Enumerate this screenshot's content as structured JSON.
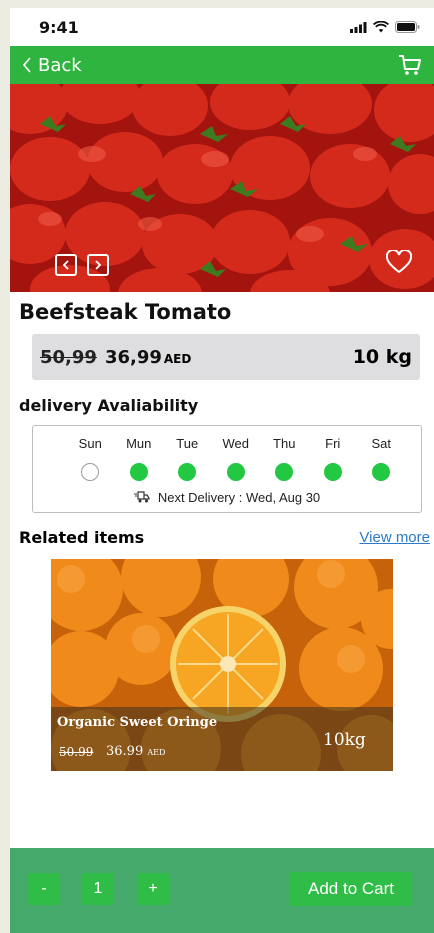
{
  "status": {
    "time": "9:41"
  },
  "nav": {
    "back_label": "Back"
  },
  "product": {
    "name": "Beefsteak Tomato",
    "old_price": "50,99",
    "new_price": "36,99",
    "currency": "AED",
    "weight": "10 kg"
  },
  "delivery": {
    "heading": "delivery Avaliability",
    "days": [
      {
        "label": "Sun",
        "available": false
      },
      {
        "label": "Mun",
        "available": true
      },
      {
        "label": "Tue",
        "available": true
      },
      {
        "label": "Wed",
        "available": true
      },
      {
        "label": "Thu",
        "available": true
      },
      {
        "label": "Fri",
        "available": true
      },
      {
        "label": "Sat",
        "available": true
      }
    ],
    "next": "Next Delivery : Wed, Aug 30"
  },
  "related": {
    "heading": "Related items",
    "view_more": "View more",
    "item": {
      "name": "Organic Sweet Oringe",
      "old_price": "50.99",
      "new_price": "36.99",
      "currency": "AED",
      "weight": "10kg"
    }
  },
  "cart": {
    "minus": "-",
    "quantity": "1",
    "plus": "+",
    "add_label": "Add to Cart"
  },
  "colors": {
    "accent": "#2fb53f",
    "footer": "#46a96c",
    "dot": "#22c742",
    "link": "#2b7bc9"
  }
}
